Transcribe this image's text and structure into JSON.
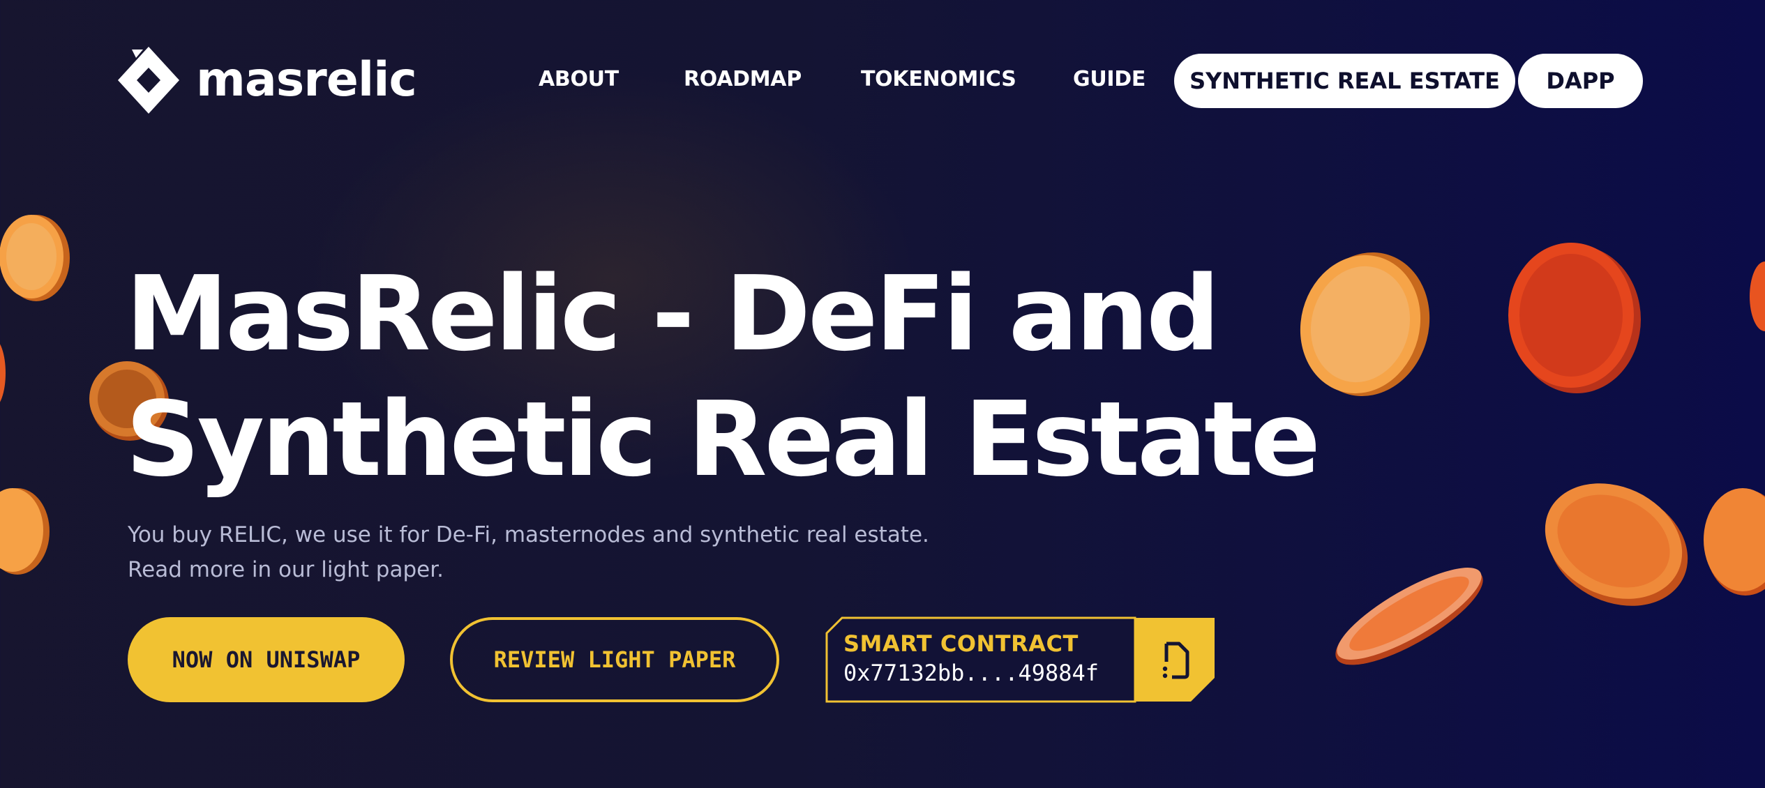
{
  "brand": {
    "name": "masrelic"
  },
  "nav": {
    "items": [
      {
        "label": "ABOUT"
      },
      {
        "label": "ROADMAP"
      },
      {
        "label": "TOKENOMICS"
      },
      {
        "label": "GUIDE"
      }
    ],
    "buttons": [
      {
        "label": "SYNTHETIC REAL ESTATE"
      },
      {
        "label": "DAPP"
      }
    ]
  },
  "hero": {
    "title_line1": "MasRelic - DeFi and",
    "title_line2": "Synthetic Real Estate",
    "subtitle_line1": "You buy RELIC, we use it for De-Fi, masternodes and synthetic real estate.",
    "subtitle_line2": "Read more in our light paper."
  },
  "actions": {
    "primary": "NOW ON UNISWAP",
    "secondary": "REVIEW LIGHT PAPER"
  },
  "contract": {
    "label": "SMART CONTRACT",
    "address": "0x77132bb....49884f",
    "icon": "copy-document-icon"
  },
  "colors": {
    "accent": "#f1c232",
    "background": "#141433",
    "coin_orange": "#f39a3c",
    "coin_red": "#e14a1c"
  }
}
